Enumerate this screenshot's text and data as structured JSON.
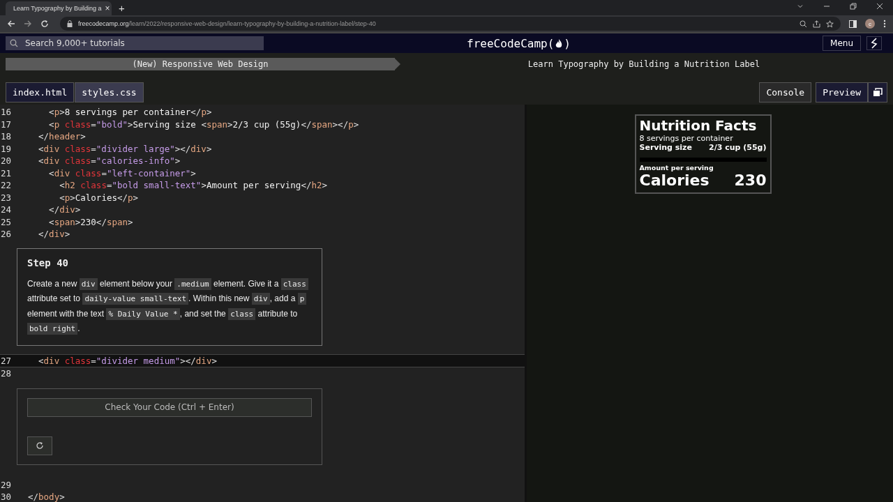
{
  "browser": {
    "tab": {
      "title": "Learn Typography by Building a",
      "close": "×"
    },
    "new_tab": "+",
    "url": {
      "host": "freecodecamp.org",
      "path": "/learn/2022/responsive-web-design/learn-typography-by-building-a-nutrition-label/step-40"
    },
    "avatar": "c"
  },
  "nav": {
    "search": {
      "placeholder": "Search 9,000+ tutorials"
    },
    "logo": {
      "name": "freeCodeCamp",
      "open": "(",
      "close": ")"
    },
    "menu": "Menu"
  },
  "breadcrumb": {
    "superblock": "(New) Responsive Web Design",
    "block": "Learn Typography by Building a Nutrition Label"
  },
  "file_tabs": [
    {
      "label": "index.html",
      "selected": true
    },
    {
      "label": "styles.css",
      "selected": false
    }
  ],
  "pane_tabs": [
    {
      "label": "Console",
      "selected": false
    },
    {
      "label": "Preview",
      "selected": true
    }
  ],
  "code_top": [
    {
      "number": "16",
      "tokens": [
        {
          "kind": "punct",
          "text": "    <"
        },
        {
          "kind": "tag",
          "text": "p"
        },
        {
          "kind": "punct",
          "text": ">"
        },
        {
          "kind": "text",
          "text": "8 servings per container"
        },
        {
          "kind": "punct",
          "text": "</"
        },
        {
          "kind": "tag",
          "text": "p"
        },
        {
          "kind": "punct",
          "text": ">"
        }
      ]
    },
    {
      "number": "17",
      "tokens": [
        {
          "kind": "punct",
          "text": "    <"
        },
        {
          "kind": "tag",
          "text": "p"
        },
        {
          "kind": "attr",
          "text": " class"
        },
        {
          "kind": "punct",
          "text": "="
        },
        {
          "kind": "string",
          "text": "\"bold\""
        },
        {
          "kind": "punct",
          "text": ">"
        },
        {
          "kind": "text",
          "text": "Serving size "
        },
        {
          "kind": "punct",
          "text": "<"
        },
        {
          "kind": "tag",
          "text": "span"
        },
        {
          "kind": "punct",
          "text": ">"
        },
        {
          "kind": "text",
          "text": "2/3 cup (55g)"
        },
        {
          "kind": "punct",
          "text": "</"
        },
        {
          "kind": "tag",
          "text": "span"
        },
        {
          "kind": "punct",
          "text": "></"
        },
        {
          "kind": "tag",
          "text": "p"
        },
        {
          "kind": "punct",
          "text": ">"
        }
      ]
    },
    {
      "number": "18",
      "tokens": [
        {
          "kind": "punct",
          "text": "  </"
        },
        {
          "kind": "tag",
          "text": "header"
        },
        {
          "kind": "punct",
          "text": ">"
        }
      ]
    },
    {
      "number": "19",
      "tokens": [
        {
          "kind": "punct",
          "text": "  <"
        },
        {
          "kind": "tag",
          "text": "div"
        },
        {
          "kind": "attr",
          "text": " class"
        },
        {
          "kind": "punct",
          "text": "="
        },
        {
          "kind": "string",
          "text": "\"divider large\""
        },
        {
          "kind": "punct",
          "text": "></"
        },
        {
          "kind": "tag",
          "text": "div"
        },
        {
          "kind": "punct",
          "text": ">"
        }
      ]
    },
    {
      "number": "20",
      "tokens": [
        {
          "kind": "punct",
          "text": "  <"
        },
        {
          "kind": "tag",
          "text": "div"
        },
        {
          "kind": "attr",
          "text": " class"
        },
        {
          "kind": "punct",
          "text": "="
        },
        {
          "kind": "string",
          "text": "\"calories-info\""
        },
        {
          "kind": "punct",
          "text": ">"
        }
      ]
    },
    {
      "number": "21",
      "tokens": [
        {
          "kind": "punct",
          "text": "    <"
        },
        {
          "kind": "tag",
          "text": "div"
        },
        {
          "kind": "attr",
          "text": " class"
        },
        {
          "kind": "punct",
          "text": "="
        },
        {
          "kind": "string",
          "text": "\"left-container\""
        },
        {
          "kind": "punct",
          "text": ">"
        }
      ]
    },
    {
      "number": "22",
      "tokens": [
        {
          "kind": "punct",
          "text": "      <"
        },
        {
          "kind": "tag",
          "text": "h2"
        },
        {
          "kind": "attr",
          "text": " class"
        },
        {
          "kind": "punct",
          "text": "="
        },
        {
          "kind": "string",
          "text": "\"bold small-text\""
        },
        {
          "kind": "punct",
          "text": ">"
        },
        {
          "kind": "text",
          "text": "Amount per serving"
        },
        {
          "kind": "punct",
          "text": "</"
        },
        {
          "kind": "tag",
          "text": "h2"
        },
        {
          "kind": "punct",
          "text": ">"
        }
      ]
    },
    {
      "number": "23",
      "tokens": [
        {
          "kind": "punct",
          "text": "      <"
        },
        {
          "kind": "tag",
          "text": "p"
        },
        {
          "kind": "punct",
          "text": ">"
        },
        {
          "kind": "text",
          "text": "Calories"
        },
        {
          "kind": "punct",
          "text": "</"
        },
        {
          "kind": "tag",
          "text": "p"
        },
        {
          "kind": "punct",
          "text": ">"
        }
      ]
    },
    {
      "number": "24",
      "tokens": [
        {
          "kind": "punct",
          "text": "    </"
        },
        {
          "kind": "tag",
          "text": "div"
        },
        {
          "kind": "punct",
          "text": ">"
        }
      ]
    },
    {
      "number": "25",
      "tokens": [
        {
          "kind": "punct",
          "text": "    <"
        },
        {
          "kind": "tag",
          "text": "span"
        },
        {
          "kind": "punct",
          "text": ">"
        },
        {
          "kind": "text",
          "text": "230"
        },
        {
          "kind": "punct",
          "text": "</"
        },
        {
          "kind": "tag",
          "text": "span"
        },
        {
          "kind": "punct",
          "text": ">"
        }
      ]
    },
    {
      "number": "26",
      "tokens": [
        {
          "kind": "punct",
          "text": "  </"
        },
        {
          "kind": "tag",
          "text": "div"
        },
        {
          "kind": "punct",
          "text": ">"
        }
      ]
    }
  ],
  "step": {
    "title": "Step 40",
    "text": [
      {
        "kind": "text",
        "text": "Create a new "
      },
      {
        "kind": "code",
        "text": "div"
      },
      {
        "kind": "text",
        "text": " element below your "
      },
      {
        "kind": "code",
        "text": ".medium"
      },
      {
        "kind": "text",
        "text": " element. Give it a "
      },
      {
        "kind": "code",
        "text": "class"
      },
      {
        "kind": "text",
        "text": " attribute set to "
      },
      {
        "kind": "code",
        "text": "daily-value small-text"
      },
      {
        "kind": "text",
        "text": ". Within this new "
      },
      {
        "kind": "code",
        "text": "div"
      },
      {
        "kind": "text",
        "text": ", add a "
      },
      {
        "kind": "code",
        "text": "p"
      },
      {
        "kind": "text",
        "text": " element with the text "
      },
      {
        "kind": "code",
        "text": "% Daily Value *"
      },
      {
        "kind": "text",
        "text": ", and set the "
      },
      {
        "kind": "code",
        "text": "class"
      },
      {
        "kind": "text",
        "text": " attribute to "
      },
      {
        "kind": "code",
        "text": "bold right"
      },
      {
        "kind": "text",
        "text": "."
      }
    ]
  },
  "code_mid": [
    {
      "number": "27",
      "tokens": [
        {
          "kind": "punct",
          "text": "  <"
        },
        {
          "kind": "tag",
          "text": "div"
        },
        {
          "kind": "attr",
          "text": " class"
        },
        {
          "kind": "punct",
          "text": "="
        },
        {
          "kind": "string",
          "text": "\"divider medium\""
        },
        {
          "kind": "punct",
          "text": "></"
        },
        {
          "kind": "tag",
          "text": "div"
        },
        {
          "kind": "punct",
          "text": ">"
        }
      ]
    },
    {
      "number": "28"
    }
  ],
  "check_button": "Check Your Code (Ctrl + Enter)",
  "code_bottom": [
    {
      "number": "29"
    },
    {
      "number": "30",
      "tokens": [
        {
          "kind": "punct",
          "text": "</"
        },
        {
          "kind": "tag",
          "text": "body"
        },
        {
          "kind": "punct",
          "text": ">"
        }
      ]
    }
  ],
  "preview": {
    "title": "Nutrition Facts",
    "servings": "8 servings per container",
    "serving_label": "Serving size",
    "serving_value": "2/3 cup (55g)",
    "amount": "Amount per serving",
    "calories_label": "Calories",
    "calories_value": "230"
  }
}
